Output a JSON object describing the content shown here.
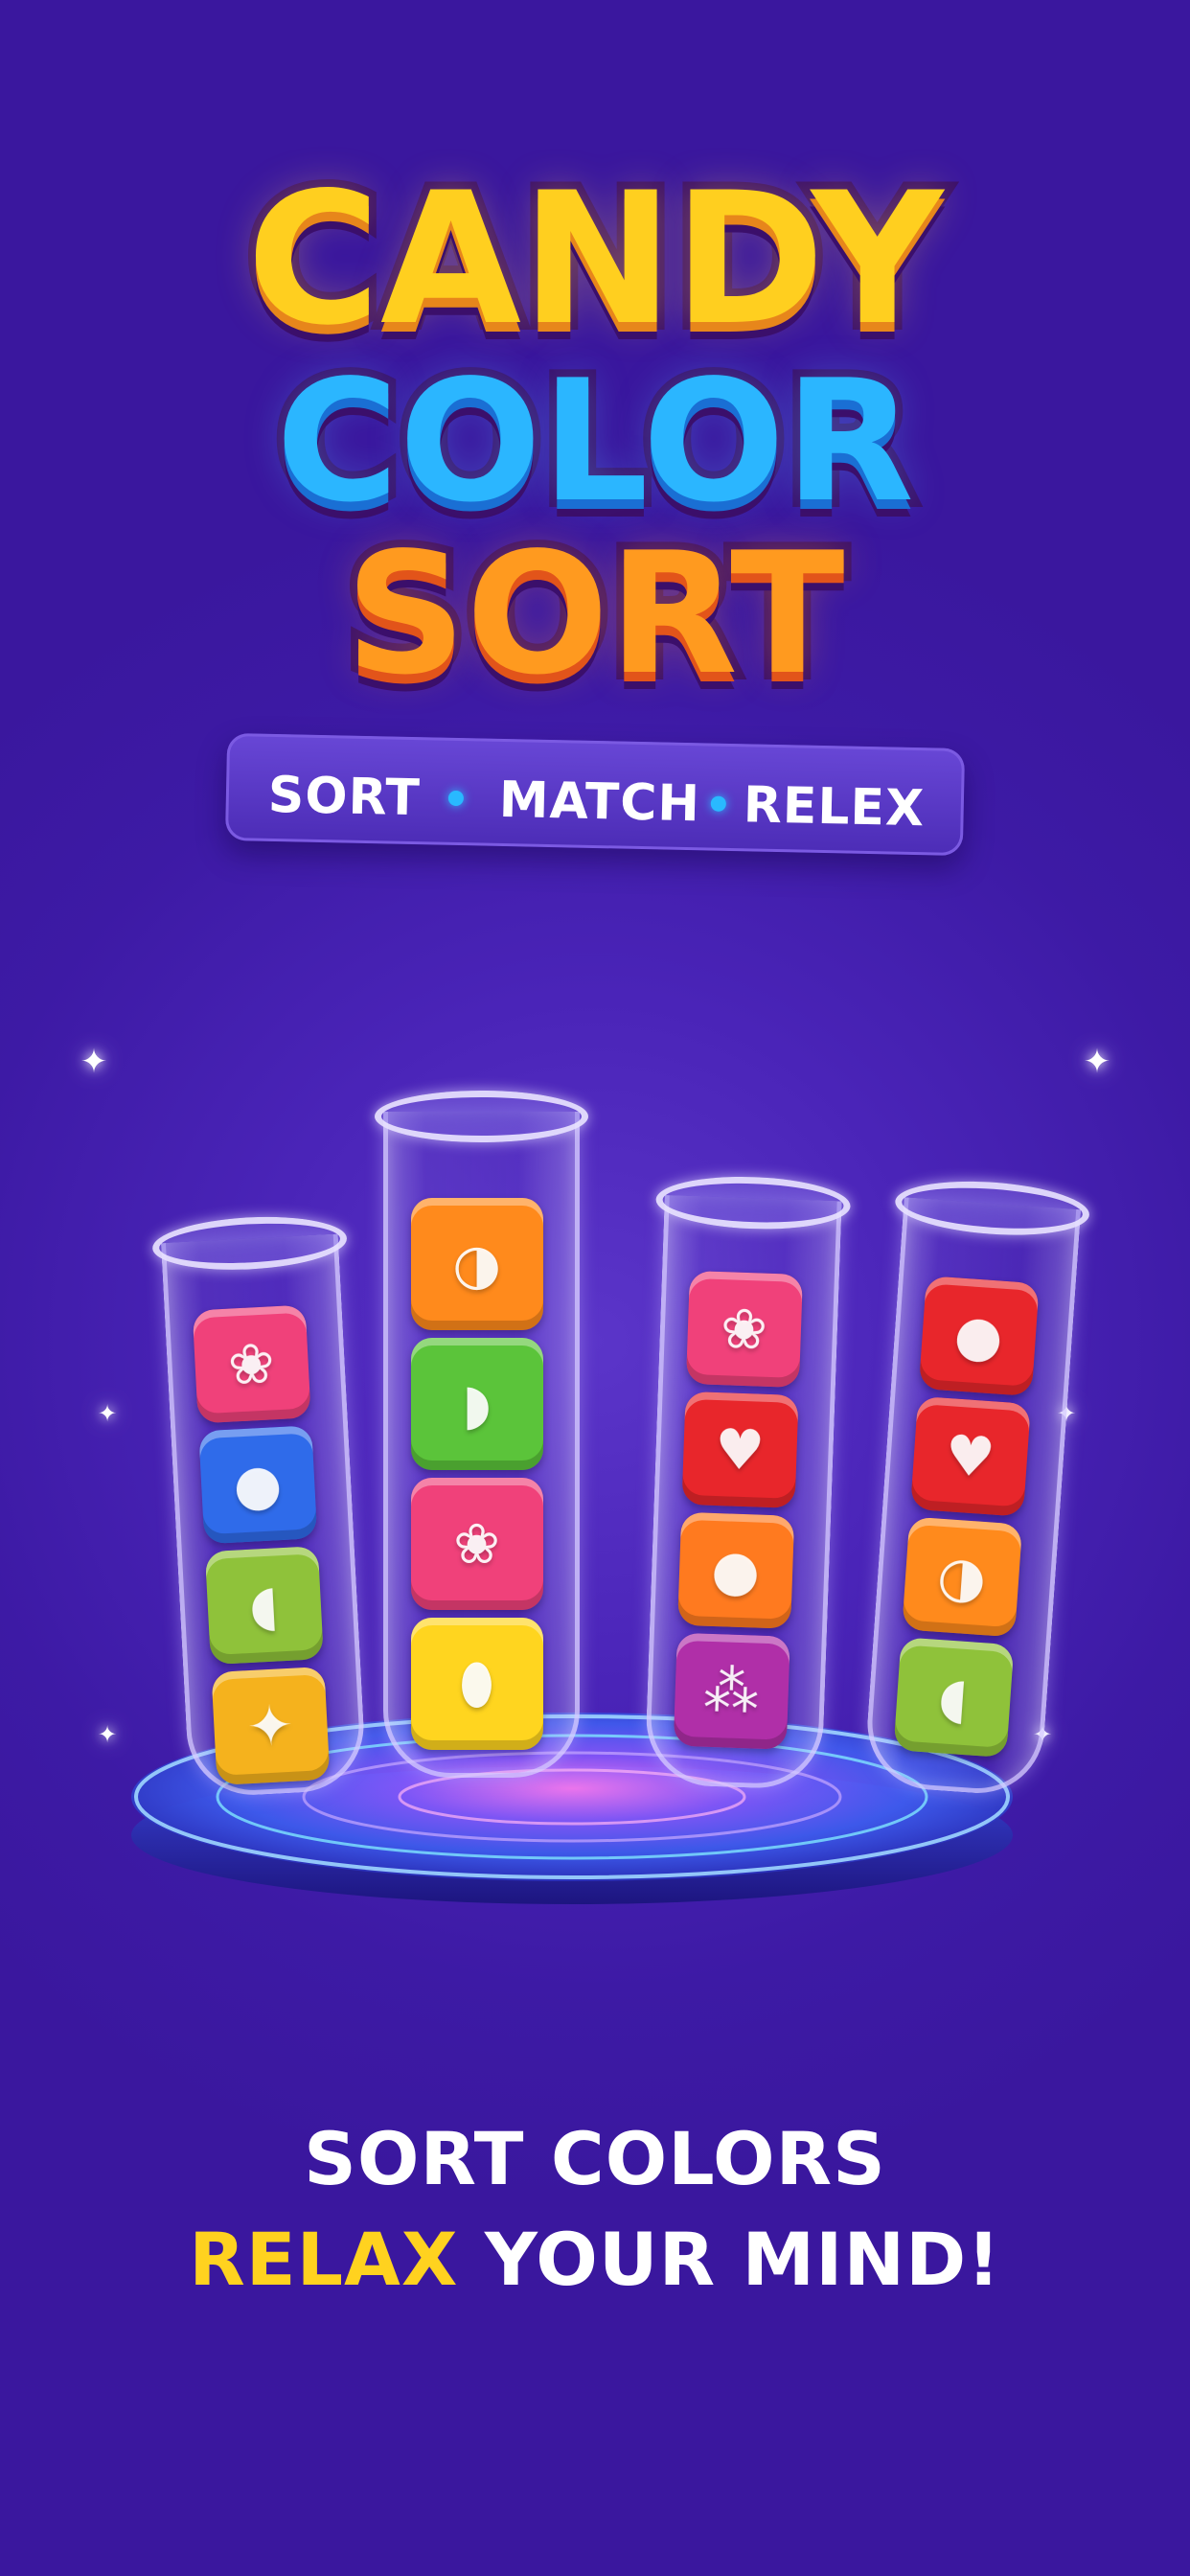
{
  "logo": {
    "line1": "CANDY",
    "line2": "COLOR",
    "line3": "SORT"
  },
  "tagline": {
    "item1": "SORT",
    "item2": "MATCH",
    "item3": "RELEX"
  },
  "tubes": [
    {
      "blocks": [
        {
          "fruit": "dragon-fruit",
          "glyph": "❀",
          "color": "#f0417a"
        },
        {
          "fruit": "blueberries",
          "glyph": "●",
          "color": "#2f6bea"
        },
        {
          "fruit": "papaya",
          "glyph": "◖",
          "color": "#8fc23a"
        },
        {
          "fruit": "pineapple",
          "glyph": "✦",
          "color": "#f5b21d"
        }
      ]
    },
    {
      "blocks": [
        {
          "fruit": "orange",
          "glyph": "◑",
          "color": "#ff8a1c"
        },
        {
          "fruit": "watermelon",
          "glyph": "◗",
          "color": "#5bc43a"
        },
        {
          "fruit": "dragon-fruit",
          "glyph": "❀",
          "color": "#f0417a"
        },
        {
          "fruit": "lemon",
          "glyph": "⬮",
          "color": "#ffd51f"
        }
      ]
    },
    {
      "blocks": [
        {
          "fruit": "dragon-fruit",
          "glyph": "❀",
          "color": "#f0417a"
        },
        {
          "fruit": "strawberry",
          "glyph": "♥",
          "color": "#e8262b"
        },
        {
          "fruit": "peach",
          "glyph": "●",
          "color": "#ff7a1f"
        },
        {
          "fruit": "grapes",
          "glyph": "⁂",
          "color": "#b02fa8"
        }
      ]
    },
    {
      "blocks": [
        {
          "fruit": "apple",
          "glyph": "●",
          "color": "#e8262b"
        },
        {
          "fruit": "strawberry",
          "glyph": "♥",
          "color": "#e8262b"
        },
        {
          "fruit": "orange",
          "glyph": "◑",
          "color": "#ff8a1c"
        },
        {
          "fruit": "papaya",
          "glyph": "◖",
          "color": "#8fc23a"
        }
      ]
    }
  ],
  "bottom": {
    "line1": "SORT COLORS",
    "line2_accent": "RELAX",
    "line2_rest": " YOUR MIND!"
  },
  "colors": {
    "background": "#4a24b8",
    "accent_yellow": "#ffd21f",
    "accent_blue": "#29b9ff",
    "logo_outline": "#3b0f6b"
  }
}
